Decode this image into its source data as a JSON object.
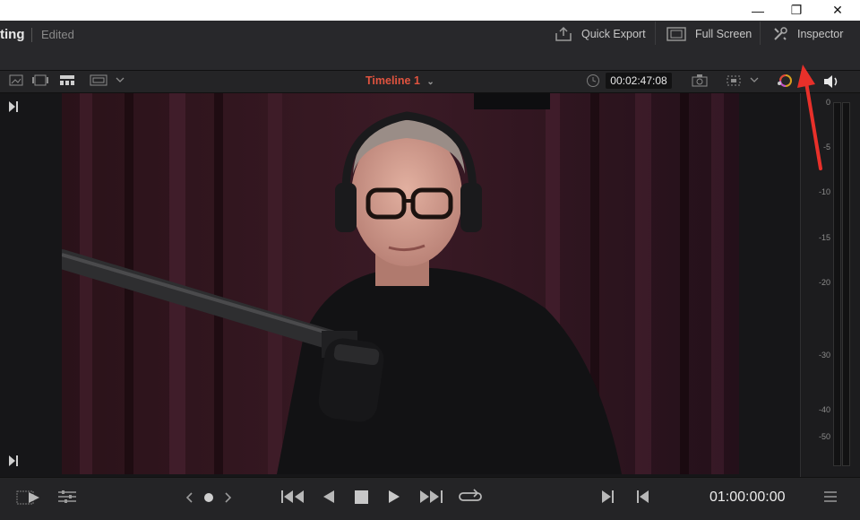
{
  "window": {
    "minimize_glyph": "—",
    "restore_glyph": "❐",
    "close_glyph": "✕"
  },
  "app": {
    "title": "ting",
    "status": "Edited"
  },
  "header": {
    "quick_export_label": "Quick Export",
    "full_screen_label": "Full Screen",
    "inspector_label": "Inspector"
  },
  "viewer_toolbar": {
    "timeline_label": "Timeline 1",
    "source_timecode": "00:02:47:08"
  },
  "audio_meter": {
    "scale": [
      "0",
      "-5",
      "-10",
      "-15",
      "-20",
      "-30",
      "-40",
      "-50"
    ]
  },
  "transport": {
    "record_timecode": "01:00:00:00"
  },
  "annotation": {
    "arrow_color": "#e8302a",
    "points_to": "Inspector"
  },
  "colors": {
    "accent_timeline": "#e0533f",
    "background": "#1c1c1e"
  }
}
